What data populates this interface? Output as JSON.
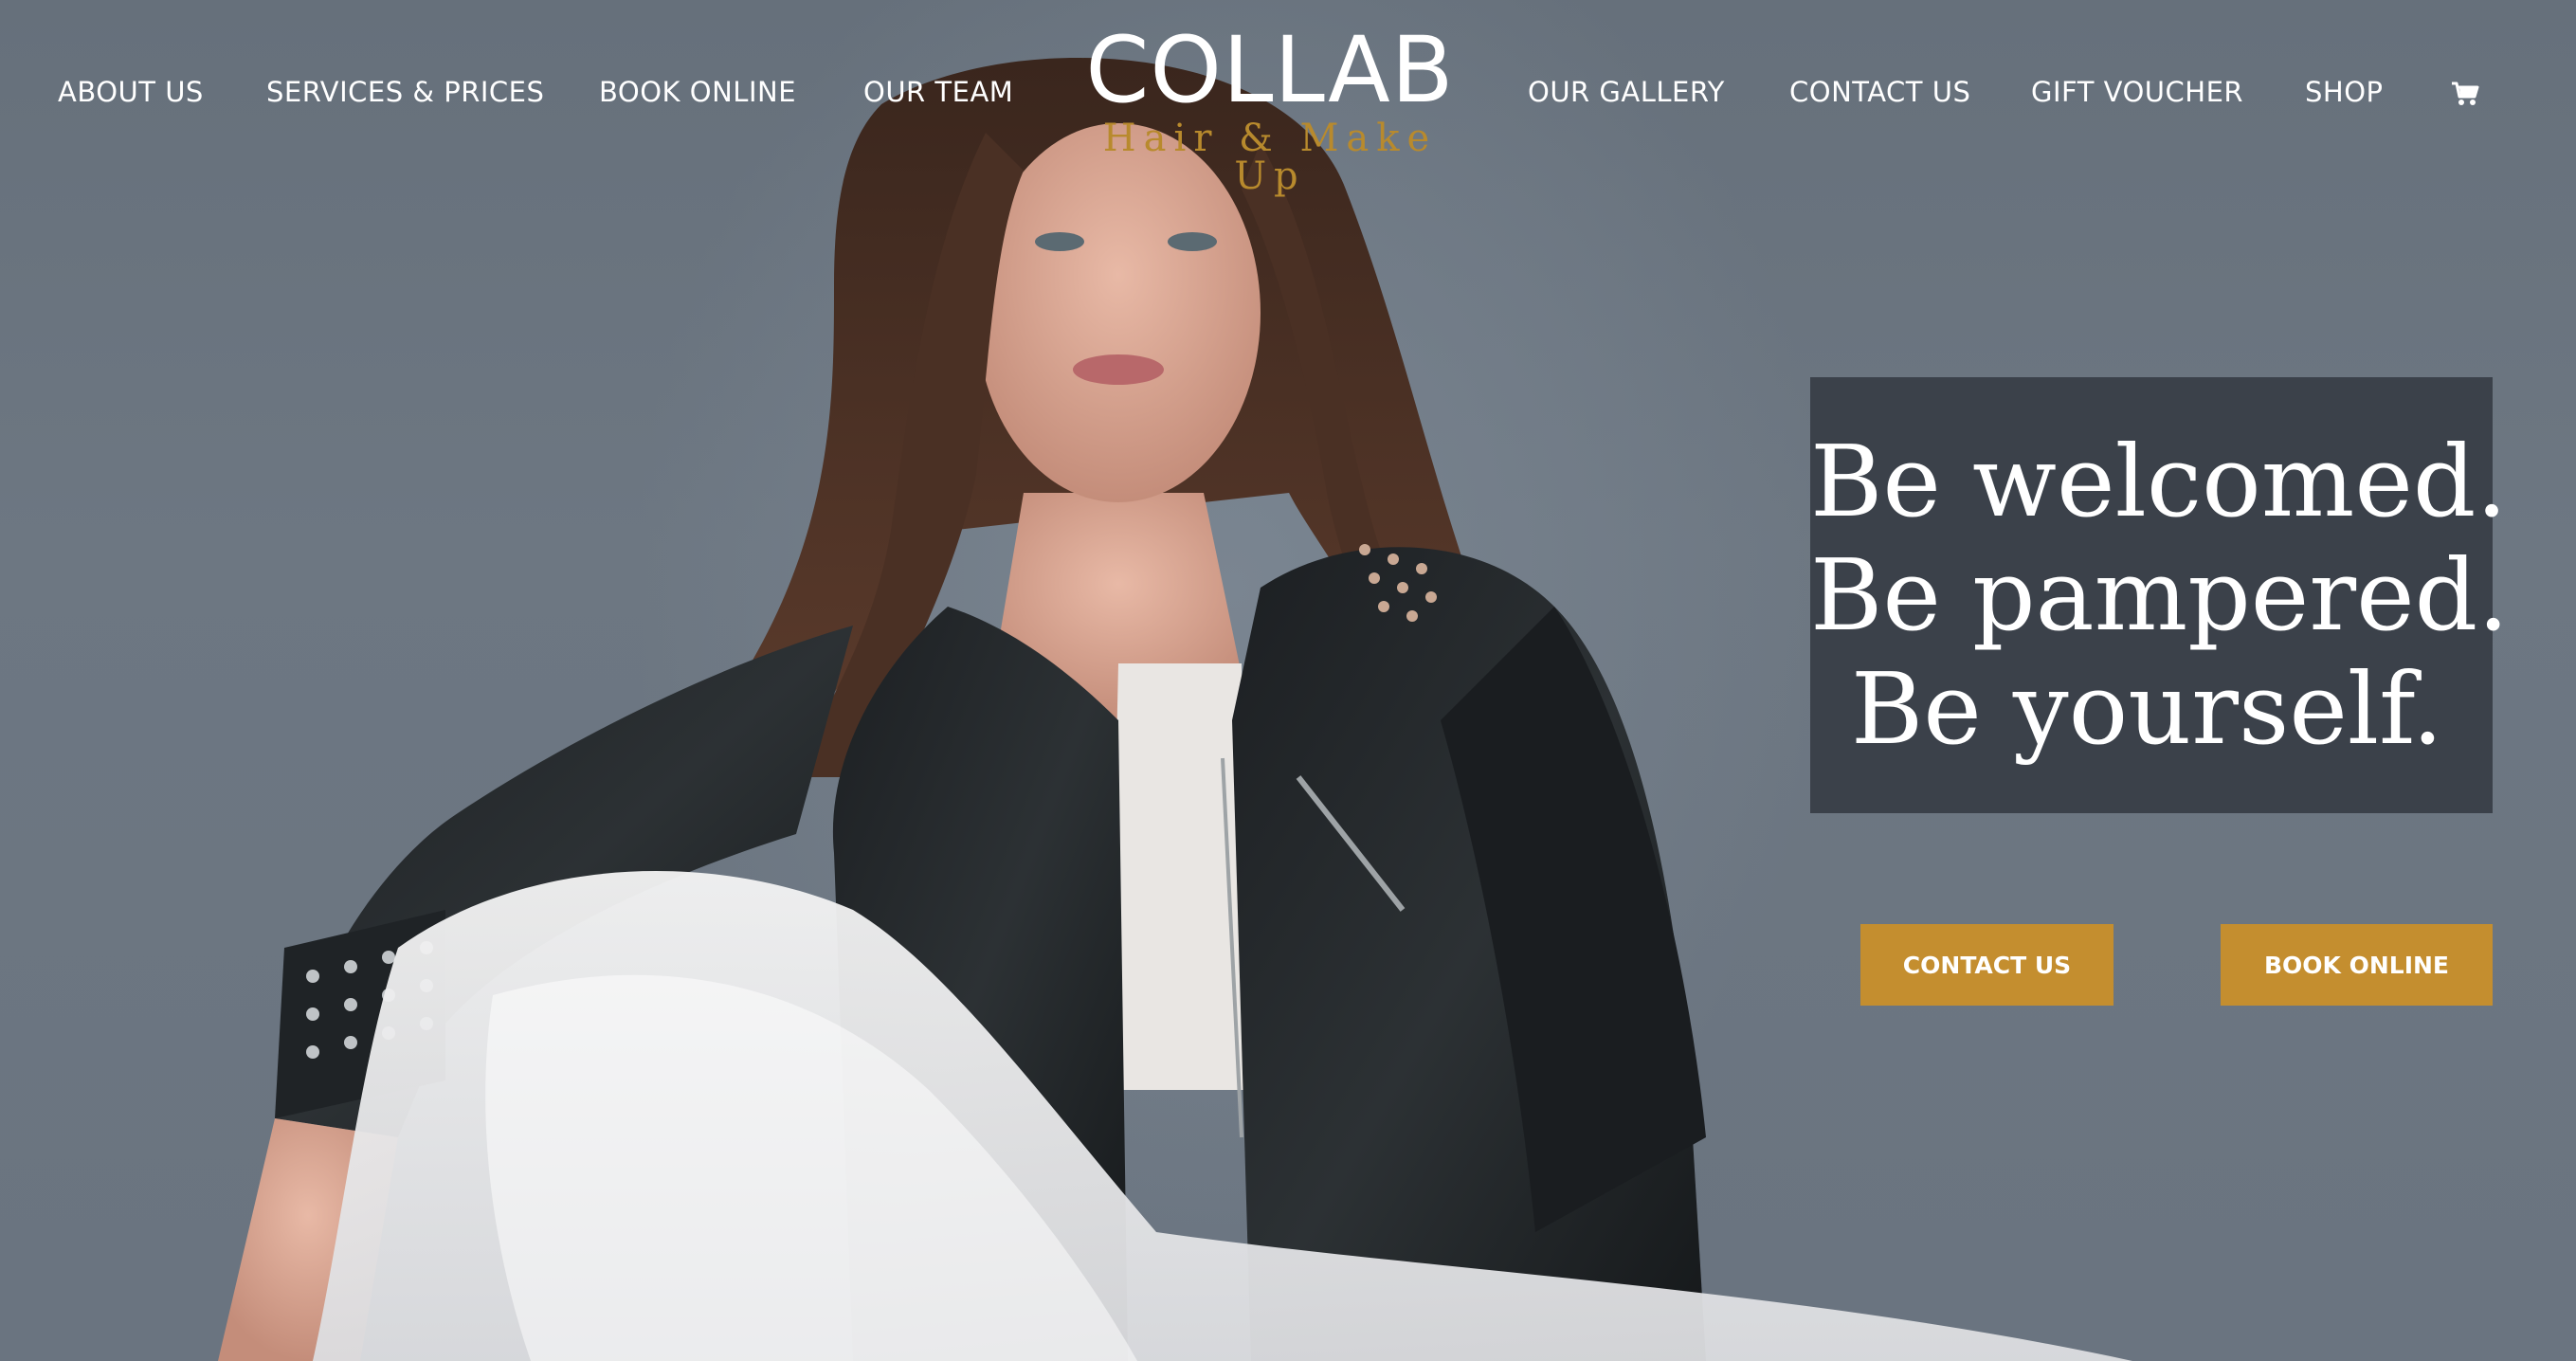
{
  "nav": {
    "left_items": [
      {
        "label": "ABOUT US"
      },
      {
        "label": "SERVICES & PRICES"
      },
      {
        "label": "BOOK ONLINE"
      },
      {
        "label": "OUR TEAM"
      }
    ],
    "right_items": [
      {
        "label": "OUR GALLERY"
      },
      {
        "label": "CONTACT US"
      },
      {
        "label": "GIFT VOUCHER"
      },
      {
        "label": "SHOP"
      }
    ],
    "cart_icon": "shopping-cart-icon"
  },
  "logo": {
    "main": "COLLAB",
    "sub": "Hair & Make Up"
  },
  "tagline": {
    "lines": [
      "Be welcomed.",
      "Be pampered.",
      "Be yourself."
    ]
  },
  "cta": {
    "contact_label": "CONTACT US",
    "book_label": "BOOK ONLINE"
  },
  "colors": {
    "accent": "#c48e2f",
    "tagline_bg": "#3b414a",
    "logo_sub": "#b88a2d",
    "background": "#6c7682"
  }
}
